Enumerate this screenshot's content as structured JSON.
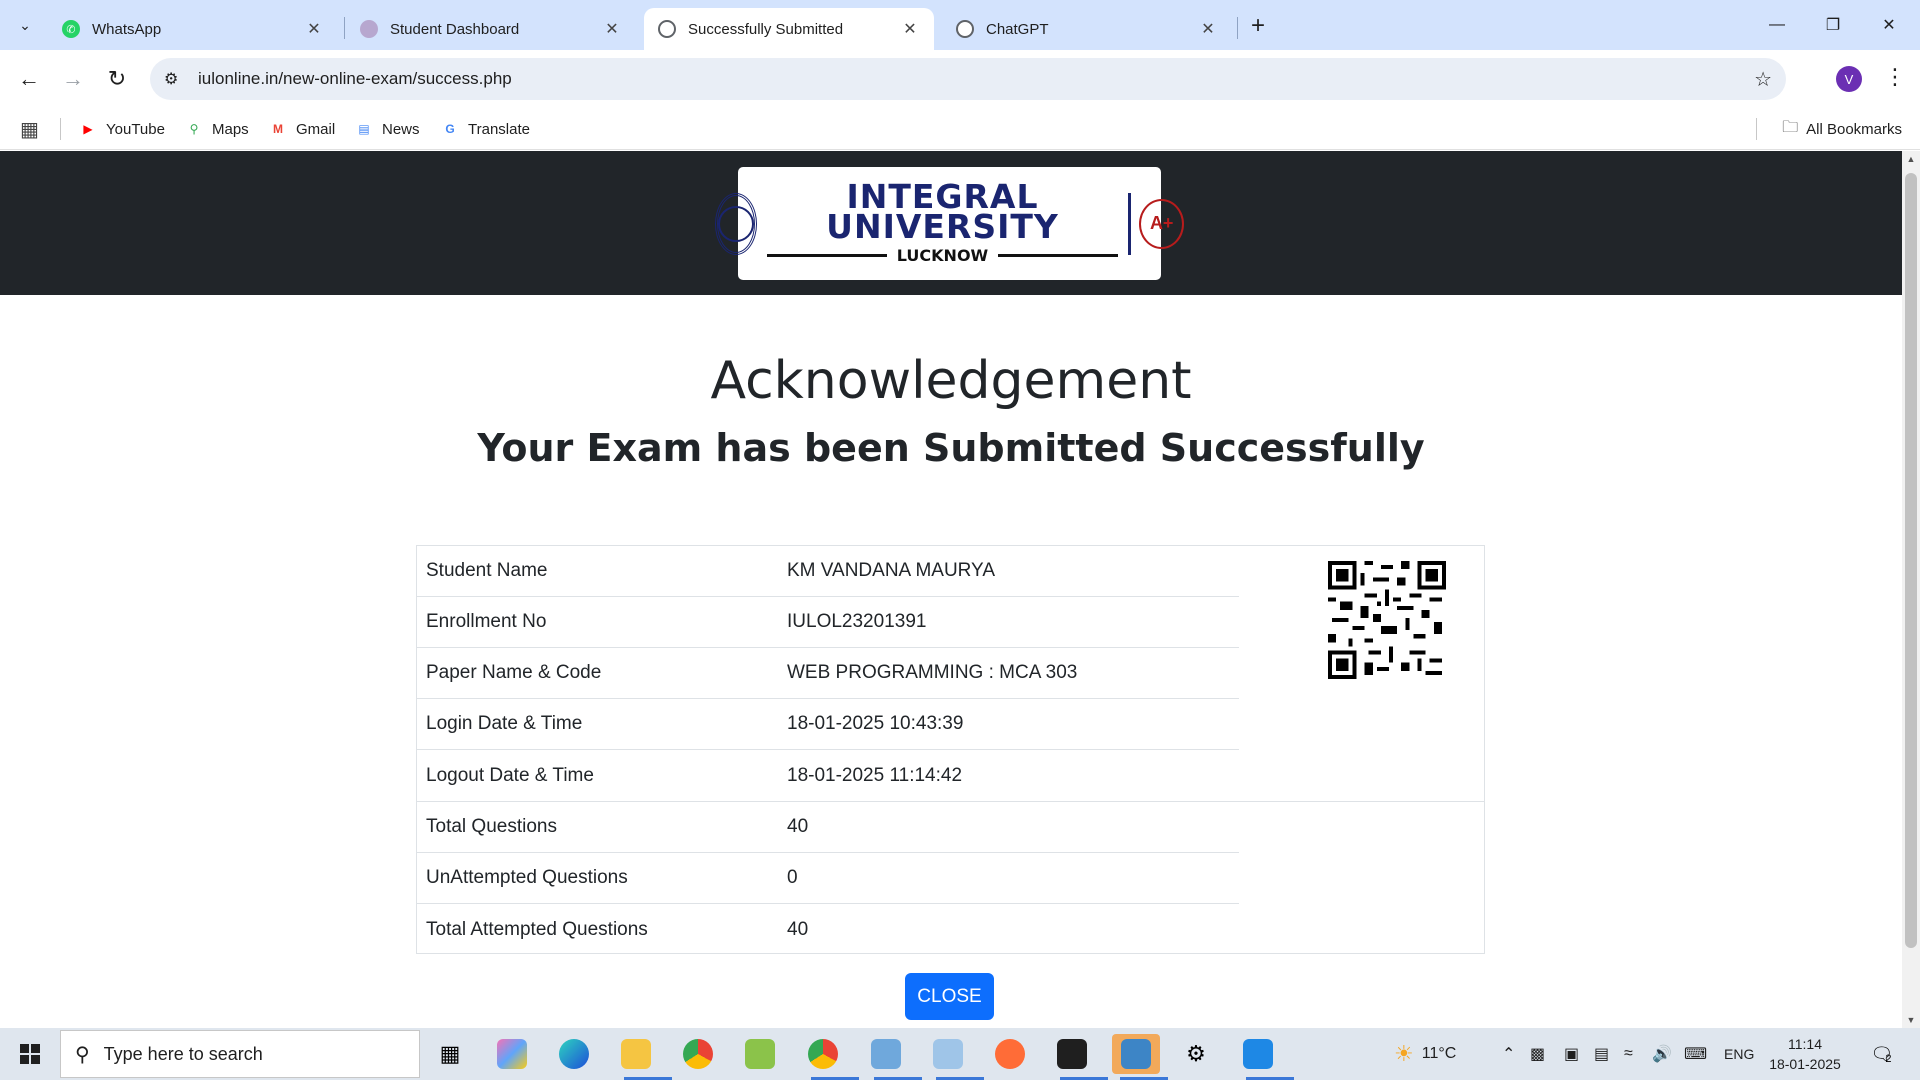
{
  "browser": {
    "tabs": [
      {
        "title": "WhatsApp",
        "favicon": "whatsapp-icon",
        "color": "#25d366"
      },
      {
        "title": "Student Dashboard",
        "favicon": "portal-icon",
        "color": "#9b86b8"
      },
      {
        "title": "Successfully Submitted",
        "favicon": "globe-icon",
        "color": "#5f6368",
        "active": true
      },
      {
        "title": "ChatGPT",
        "favicon": "chatgpt-icon",
        "color": "#5f6368"
      }
    ],
    "url": "iulonline.in/new-online-exam/success.php",
    "profile_initial": "V",
    "bookmarks": [
      {
        "label": "YouTube",
        "icon": "youtube-icon",
        "color": "#ff0000"
      },
      {
        "label": "Maps",
        "icon": "maps-icon",
        "color": "#34a853"
      },
      {
        "label": "Gmail",
        "icon": "gmail-icon",
        "color": "#ea4335"
      },
      {
        "label": "News",
        "icon": "news-icon",
        "color": "#4285f4"
      },
      {
        "label": "Translate",
        "icon": "translate-icon",
        "color": "#4285f4"
      }
    ],
    "all_bookmarks": "All Bookmarks"
  },
  "header": {
    "logo_line1": "INTEGRAL",
    "logo_line2": "UNIVERSITY",
    "logo_city": "LUCKNOW",
    "naac_grade": "A+"
  },
  "page": {
    "title": "Acknowledgement",
    "subtitle": "Your Exam has been Submitted Successfully",
    "rows": [
      {
        "label": "Student Name",
        "value": "KM VANDANA MAURYA"
      },
      {
        "label": "Enrollment No",
        "value": "IULOL23201391"
      },
      {
        "label": "Paper Name & Code",
        "value": "WEB PROGRAMMING  : MCA 303"
      },
      {
        "label": "Login Date & Time",
        "value": "18-01-2025 10:43:39"
      },
      {
        "label": "Logout Date & Time",
        "value": "18-01-2025 11:14:42"
      },
      {
        "label": "Total Questions",
        "value": "40"
      },
      {
        "label": "UnAttempted Questions",
        "value": "0"
      },
      {
        "label": "Total Attempted Questions",
        "value": "40"
      }
    ],
    "close_label": "CLOSE",
    "accent": "#0d6efd",
    "header_bg": "#212529"
  },
  "taskbar": {
    "search_placeholder": "Type here to search",
    "weather": "11°C",
    "language": "ENG",
    "time": "11:14",
    "date": "18-01-2025",
    "notifications": "2"
  }
}
